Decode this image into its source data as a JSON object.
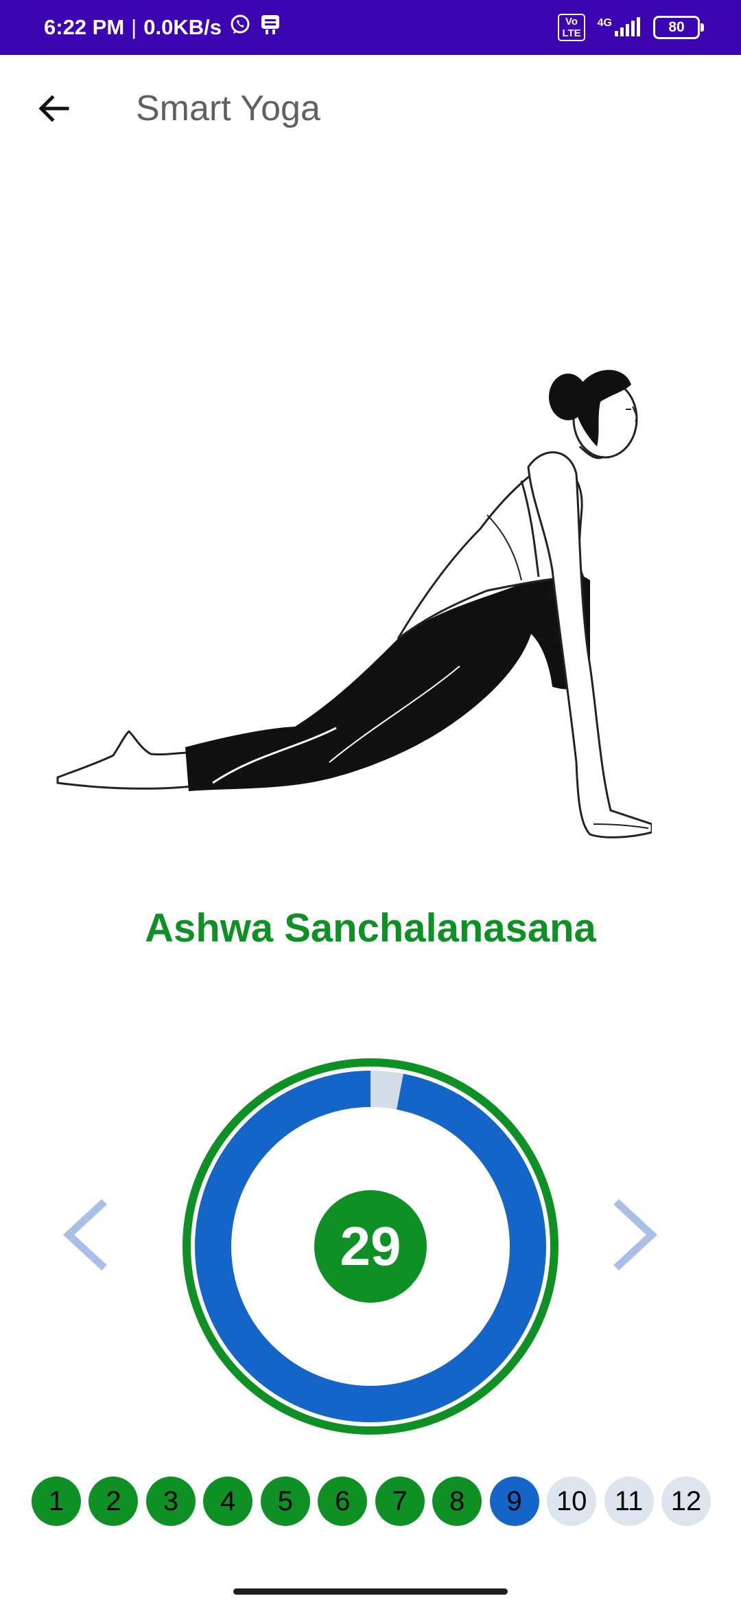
{
  "status_bar": {
    "time": "6:22 PM",
    "separator": "|",
    "net_speed": "0.0KB/s",
    "volte_line1": "Vo",
    "volte_line2": "LTE",
    "network": "4G",
    "battery": "80"
  },
  "app_bar": {
    "title": "Smart Yoga",
    "back_icon": "arrow-left-icon"
  },
  "pose": {
    "name": "Ashwa Sanchalanasana",
    "illustration": "yoga-pose-illustration"
  },
  "timer": {
    "seconds_left": "29",
    "progress_fraction": 0.97,
    "ring_color": "#1565c8",
    "border_color": "#0f9025",
    "remaining_color": "#d2dde8"
  },
  "navigation": {
    "prev_icon": "chevron-left-icon",
    "next_icon": "chevron-right-icon",
    "arrow_color": "#a9bfe6"
  },
  "steps": [
    {
      "label": "1",
      "state": "done"
    },
    {
      "label": "2",
      "state": "done"
    },
    {
      "label": "3",
      "state": "done"
    },
    {
      "label": "4",
      "state": "done"
    },
    {
      "label": "5",
      "state": "done"
    },
    {
      "label": "6",
      "state": "done"
    },
    {
      "label": "7",
      "state": "done"
    },
    {
      "label": "8",
      "state": "done"
    },
    {
      "label": "9",
      "state": "current"
    },
    {
      "label": "10",
      "state": "pending"
    },
    {
      "label": "11",
      "state": "pending"
    },
    {
      "label": "12",
      "state": "pending"
    }
  ],
  "colors": {
    "status_bar": "#3c05b1",
    "accent_green": "#0f9025",
    "accent_blue": "#1565c8"
  }
}
